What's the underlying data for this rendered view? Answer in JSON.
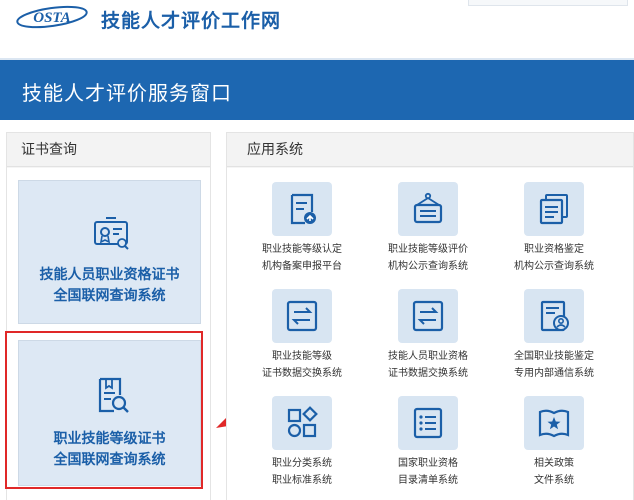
{
  "header": {
    "logo_text": "OSTA",
    "site_title": "技能人才评价工作网"
  },
  "banner": {
    "title": "技能人才评价服务窗口"
  },
  "cert_panel": {
    "title": "证书查询",
    "cards": [
      {
        "line1": "技能人员职业资格证书",
        "line2": "全国联网查询系统",
        "icon": "certificate-icon"
      },
      {
        "line1": "职业技能等级证书",
        "line2": "全国联网查询系统",
        "icon": "document-search-icon"
      }
    ]
  },
  "apps_panel": {
    "title": "应用系统",
    "apps": [
      {
        "line1": "职业技能等级认定",
        "line2": "机构备案申报平台",
        "icon": "upload-document-icon"
      },
      {
        "line1": "职业技能等级评价",
        "line2": "机构公示查询系统",
        "icon": "hanging-sign-icon"
      },
      {
        "line1": "职业资格鉴定",
        "line2": "机构公示查询系统",
        "icon": "stacked-documents-icon"
      },
      {
        "line1": "职业技能等级",
        "line2": "证书数据交换系统",
        "icon": "exchange-icon"
      },
      {
        "line1": "技能人员职业资格",
        "line2": "证书数据交换系统",
        "icon": "exchange-icon"
      },
      {
        "line1": "全国职业技能鉴定",
        "line2": "专用内部通信系统",
        "icon": "user-document-icon"
      },
      {
        "line1": "职业分类系统",
        "line2": "职业标准系统",
        "icon": "category-grid-icon"
      },
      {
        "line1": "国家职业资格",
        "line2": "目录清单系统",
        "icon": "list-icon"
      },
      {
        "line1": "相关政策",
        "line2": "文件系统",
        "icon": "policy-book-icon"
      }
    ]
  },
  "colors": {
    "brand_blue": "#1b5fa8",
    "banner_blue": "#1d67b1",
    "tile_blue": "#d8e5f2",
    "highlight_red": "#e02828"
  }
}
